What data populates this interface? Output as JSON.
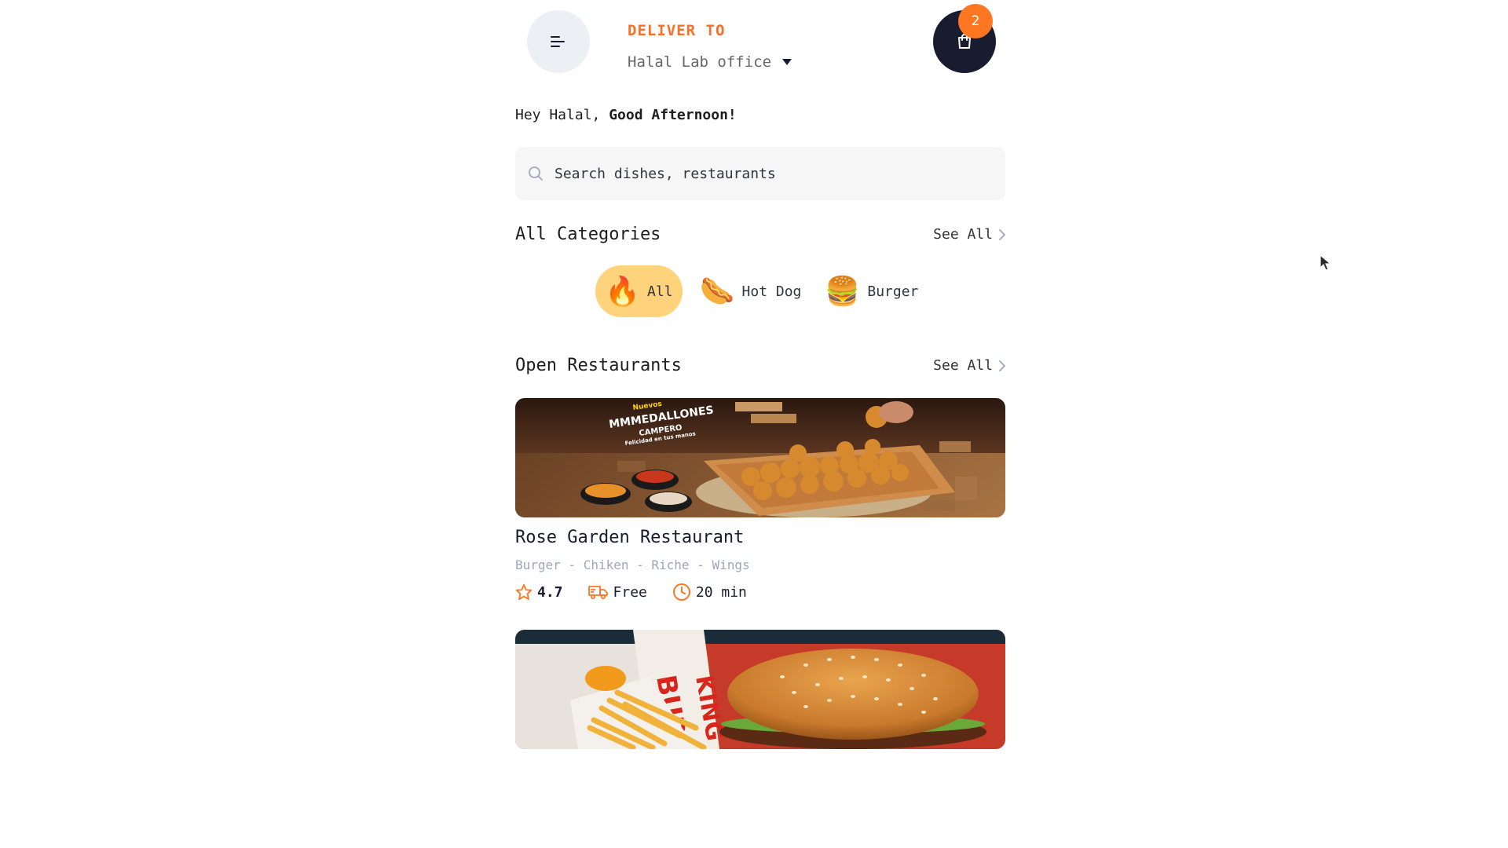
{
  "header": {
    "deliver_label": "DELIVER TO",
    "location": "Halal Lab office",
    "cart_count": "2"
  },
  "greeting": {
    "prefix": "Hey Halal,",
    "emphasis": "Good Afternoon!"
  },
  "search": {
    "placeholder": "Search dishes, restaurants"
  },
  "categories": {
    "title": "All Categories",
    "see_all": "See All",
    "items": [
      {
        "label": "All",
        "icon": "fire-icon",
        "emoji": "🔥",
        "active": true
      },
      {
        "label": "Hot Dog",
        "icon": "hotdog-icon",
        "emoji": "🌭",
        "active": false
      },
      {
        "label": "Burger",
        "icon": "burger-icon",
        "emoji": "🍔",
        "active": false
      }
    ]
  },
  "restaurants": {
    "title": "Open Restaurants",
    "see_all": "See All",
    "items": [
      {
        "name": "Rose Garden Restaurant",
        "tags": "Burger - Chiken - Riche - Wings",
        "rating": "4.7",
        "delivery": "Free",
        "time": "20 min",
        "image_text": [
          "Nuevos",
          "MMMEDALLONES",
          "CAMPERO",
          "Felicidad en tus manos"
        ]
      },
      {
        "image_text": [
          "BURGER",
          "KING"
        ]
      }
    ]
  },
  "colors": {
    "accent": "#fc6e2a",
    "badge": "#ff7622",
    "pill_active": "#ffd27c",
    "dark": "#181c2e"
  }
}
